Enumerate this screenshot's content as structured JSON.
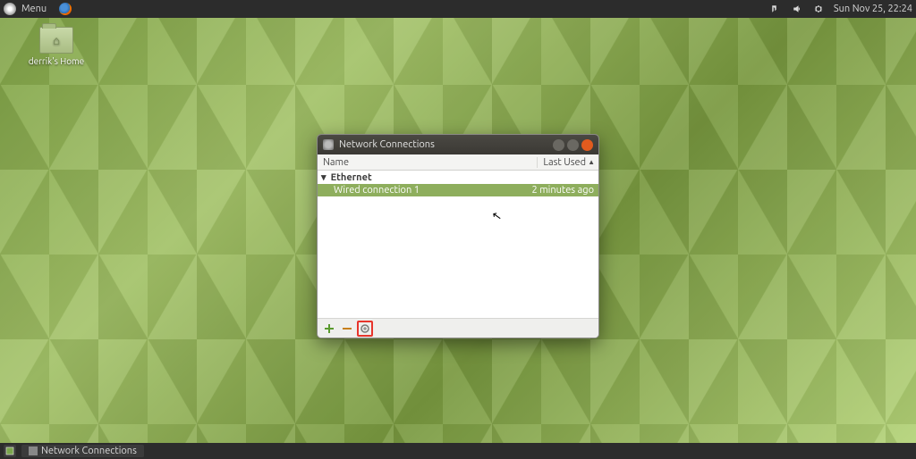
{
  "top_panel": {
    "menu_label": "Menu",
    "clock": "Sun Nov 25, 22:24"
  },
  "desktop": {
    "home_label": "derrik's Home"
  },
  "window": {
    "title": "Network Connections",
    "columns": {
      "name": "Name",
      "last_used": "Last Used"
    },
    "group": "Ethernet",
    "connection": {
      "name": "Wired connection 1",
      "last_used": "2 minutes ago"
    }
  },
  "bottom_panel": {
    "task_label": "Network Connections"
  }
}
